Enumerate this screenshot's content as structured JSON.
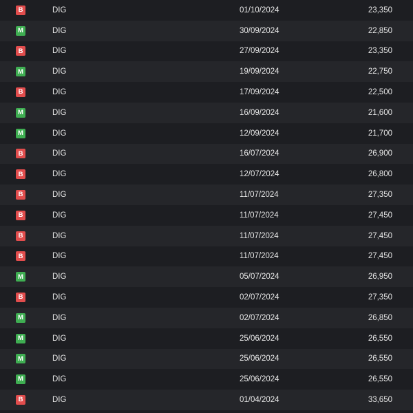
{
  "colors": {
    "background": "#1d1e22",
    "row_alt": "#25262a",
    "badge_b": "#e24d4d",
    "badge_m": "#3fae52",
    "text": "#e6e6e6"
  },
  "transactions": [
    {
      "type": "B",
      "symbol": "DIG",
      "date": "01/10/2024",
      "price": "23,350"
    },
    {
      "type": "M",
      "symbol": "DIG",
      "date": "30/09/2024",
      "price": "22,850"
    },
    {
      "type": "B",
      "symbol": "DIG",
      "date": "27/09/2024",
      "price": "23,350"
    },
    {
      "type": "M",
      "symbol": "DIG",
      "date": "19/09/2024",
      "price": "22,750"
    },
    {
      "type": "B",
      "symbol": "DIG",
      "date": "17/09/2024",
      "price": "22,500"
    },
    {
      "type": "M",
      "symbol": "DIG",
      "date": "16/09/2024",
      "price": "21,600"
    },
    {
      "type": "M",
      "symbol": "DIG",
      "date": "12/09/2024",
      "price": "21,700"
    },
    {
      "type": "B",
      "symbol": "DIG",
      "date": "16/07/2024",
      "price": "26,900"
    },
    {
      "type": "B",
      "symbol": "DIG",
      "date": "12/07/2024",
      "price": "26,800"
    },
    {
      "type": "B",
      "symbol": "DIG",
      "date": "11/07/2024",
      "price": "27,350"
    },
    {
      "type": "B",
      "symbol": "DIG",
      "date": "11/07/2024",
      "price": "27,450"
    },
    {
      "type": "B",
      "symbol": "DIG",
      "date": "11/07/2024",
      "price": "27,450"
    },
    {
      "type": "B",
      "symbol": "DIG",
      "date": "11/07/2024",
      "price": "27,450"
    },
    {
      "type": "M",
      "symbol": "DIG",
      "date": "05/07/2024",
      "price": "26,950"
    },
    {
      "type": "B",
      "symbol": "DIG",
      "date": "02/07/2024",
      "price": "27,350"
    },
    {
      "type": "M",
      "symbol": "DIG",
      "date": "02/07/2024",
      "price": "26,850"
    },
    {
      "type": "M",
      "symbol": "DIG",
      "date": "25/06/2024",
      "price": "26,550"
    },
    {
      "type": "M",
      "symbol": "DIG",
      "date": "25/06/2024",
      "price": "26,550"
    },
    {
      "type": "M",
      "symbol": "DIG",
      "date": "25/06/2024",
      "price": "26,550"
    },
    {
      "type": "B",
      "symbol": "DIG",
      "date": "01/04/2024",
      "price": "33,650"
    }
  ]
}
